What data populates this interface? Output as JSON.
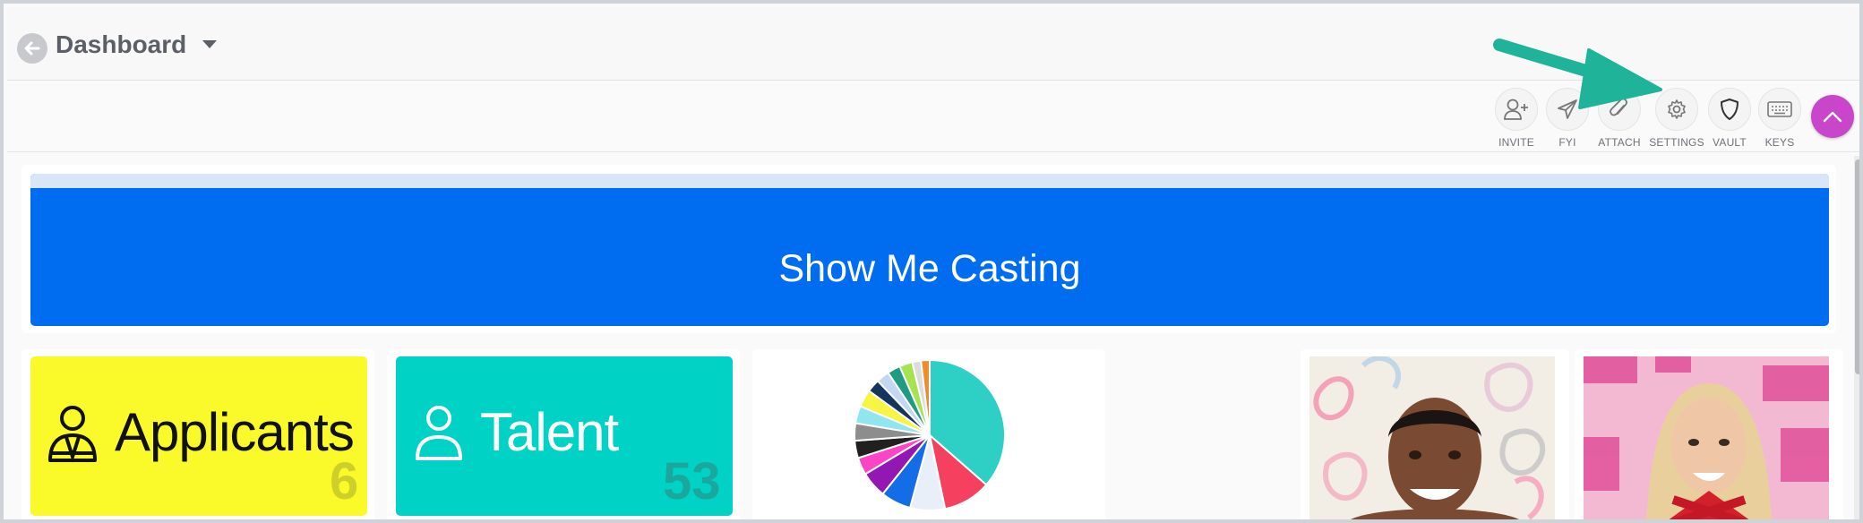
{
  "header": {
    "title": "Dashboard"
  },
  "toolbar": {
    "invite": "INVITE",
    "fyi": "FYI",
    "attach": "ATTACH",
    "settings": "SETTINGS",
    "vault": "VAULT",
    "keys": "KEYS"
  },
  "banner": {
    "label": "Show Me Casting",
    "color": "#006cf0"
  },
  "cards": {
    "applicants": {
      "label": "Applicants",
      "count": "6",
      "color": "#fafa2a"
    },
    "talent": {
      "label": "Talent",
      "count": "53",
      "color": "#00d3c5"
    }
  },
  "accent": {
    "arrow": "#1fb39a",
    "fab": "#c945c9"
  },
  "chart_data": {
    "type": "pie",
    "title": "",
    "slices": [
      {
        "value": 39,
        "color": "#2ecfc4"
      },
      {
        "value": 11,
        "color": "#f5405f"
      },
      {
        "value": 8,
        "color": "#e9eff9"
      },
      {
        "value": 7,
        "color": "#136de6"
      },
      {
        "value": 6,
        "color": "#9318b3"
      },
      {
        "value": 4,
        "color": "#fb44c6"
      },
      {
        "value": 4,
        "color": "#202020"
      },
      {
        "value": 4,
        "color": "#8d8d8d"
      },
      {
        "value": 4,
        "color": "#8fe6ef"
      },
      {
        "value": 4,
        "color": "#f5f542"
      },
      {
        "value": 3,
        "color": "#14355f"
      },
      {
        "value": 3,
        "color": "#c3d7f3"
      },
      {
        "value": 3,
        "color": "#1e9b82"
      },
      {
        "value": 3,
        "color": "#a6e34f"
      },
      {
        "value": 2,
        "color": "#dcdcdc"
      },
      {
        "value": 2,
        "color": "#f28c28"
      }
    ]
  }
}
